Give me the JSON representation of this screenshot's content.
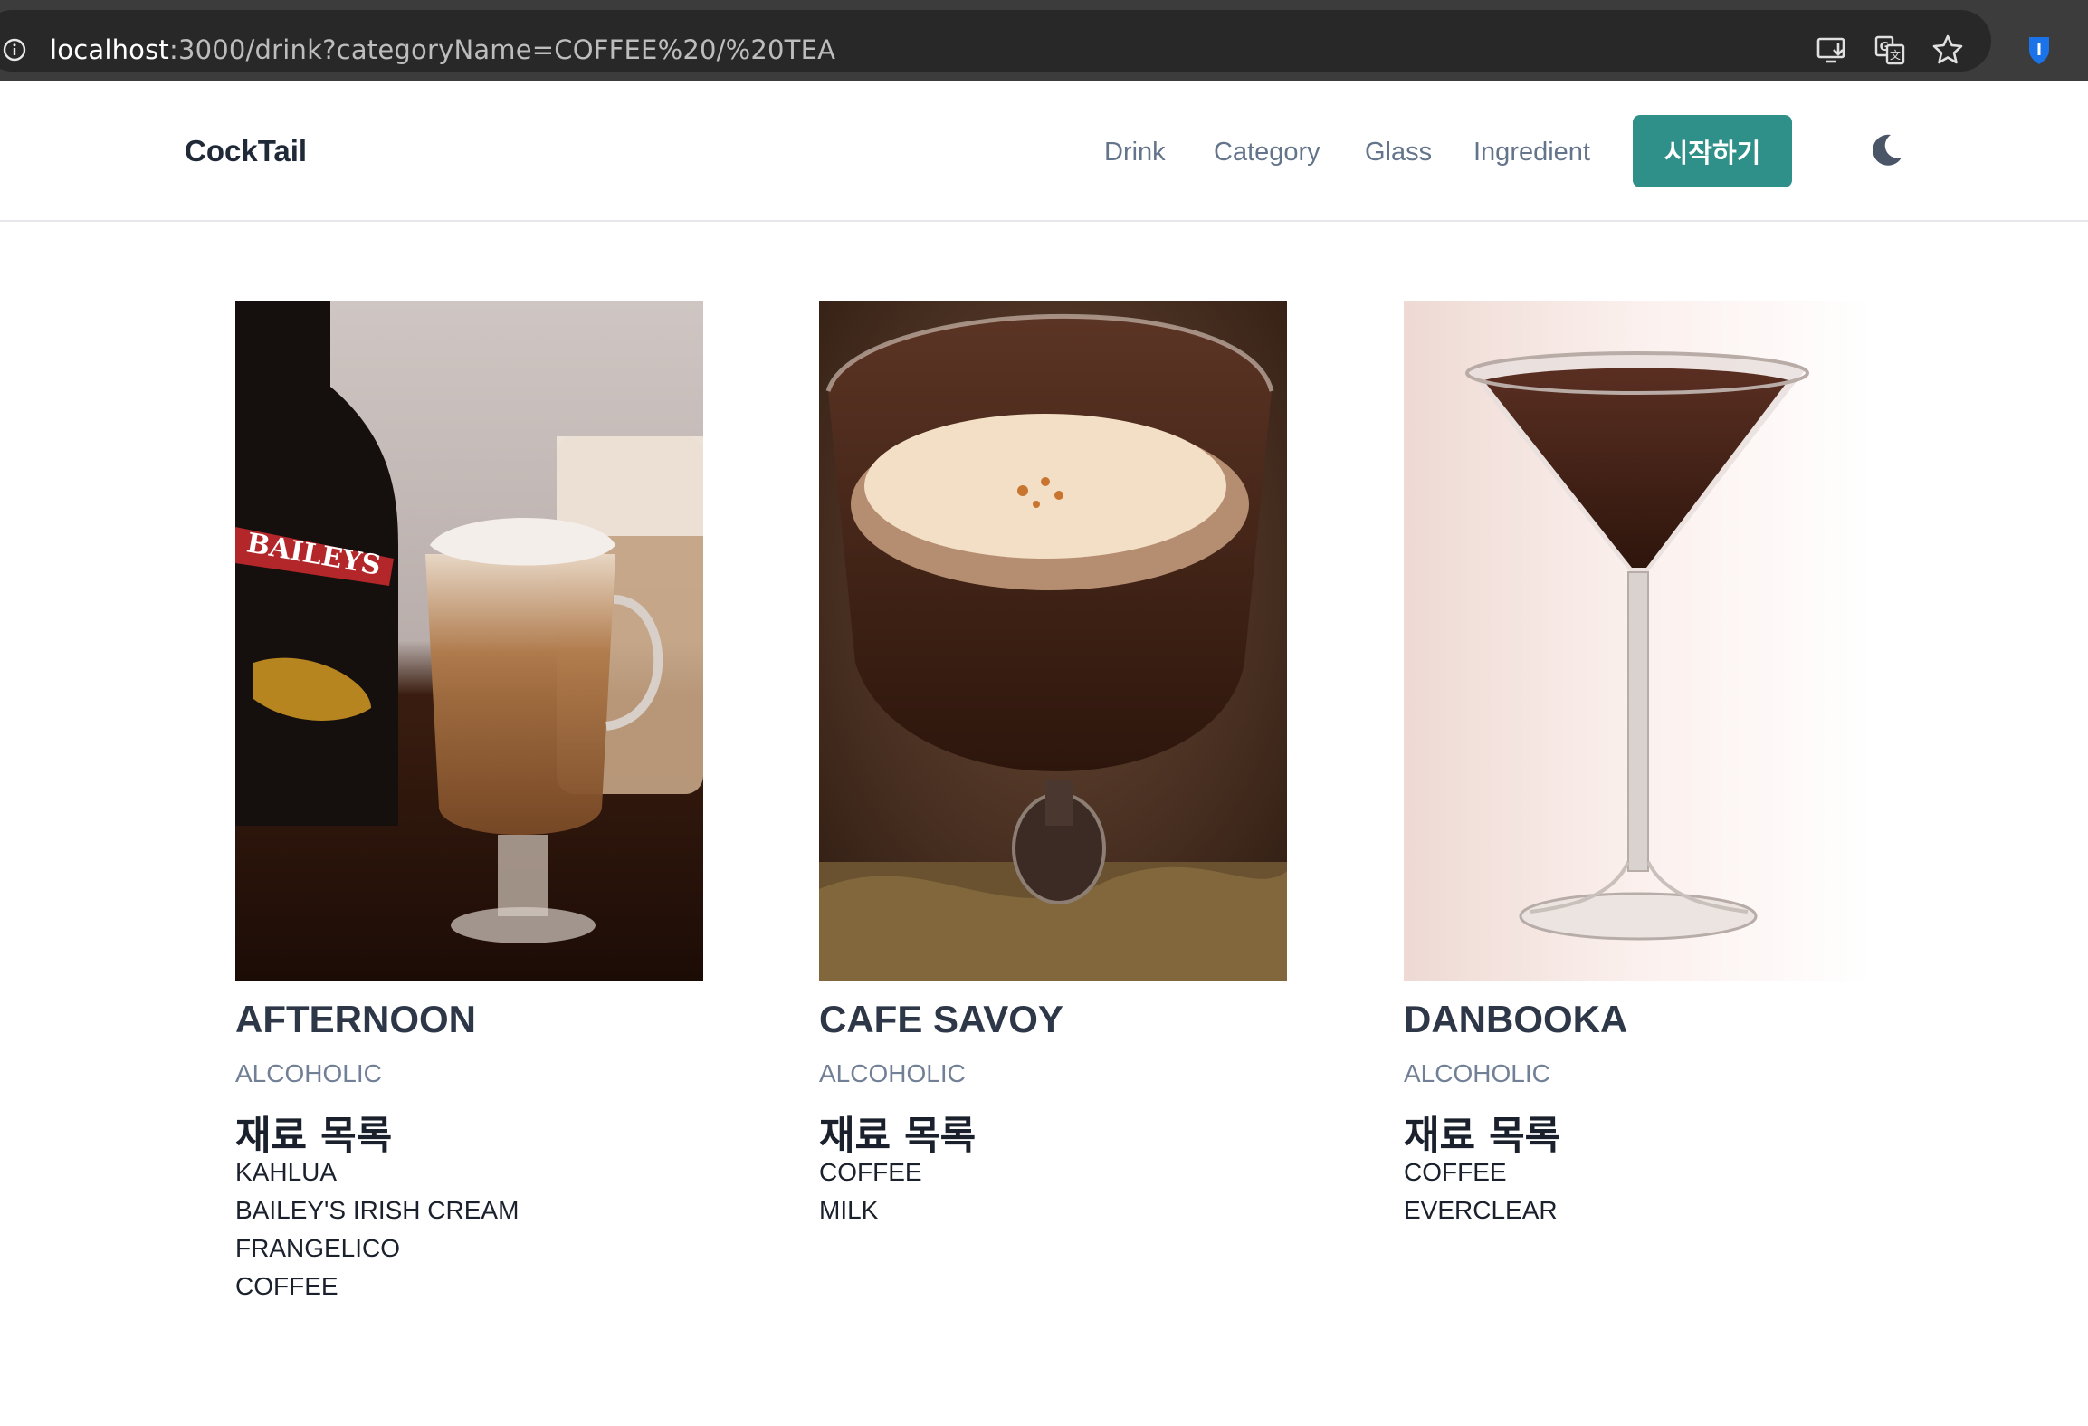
{
  "browser": {
    "url_host": "localhost",
    "url_rest": ":3000/drink?categoryName=COFFEE%20/%20TEA"
  },
  "nav": {
    "brand": "CockTail",
    "links": [
      "Drink",
      "Category",
      "Glass",
      "Ingredient"
    ],
    "start_button": "시작하기"
  },
  "cards": [
    {
      "title": "AFTERNOON",
      "type": "ALCOHOLIC",
      "heading": "재료 목록",
      "ingredients": [
        "KAHLUA",
        "BAILEY'S IRISH CREAM",
        "FRANGELICO",
        "COFFEE"
      ]
    },
    {
      "title": "CAFE SAVOY",
      "type": "ALCOHOLIC",
      "heading": "재료 목록",
      "ingredients": [
        "COFFEE",
        "MILK"
      ]
    },
    {
      "title": "DANBOOKA",
      "type": "ALCOHOLIC",
      "heading": "재료 목록",
      "ingredients": [
        "COFFEE",
        "EVERCLEAR"
      ]
    }
  ],
  "photo_logo_text": "BAILEYS",
  "colors": {
    "accent": "#2f8f89",
    "chrome_bg": "#3c3c3c",
    "omnibox_bg": "#282828",
    "title_text": "#2d3748",
    "muted_text": "#718096",
    "nav_text": "#64748b"
  },
  "icons": {
    "omnibox": "info-icon",
    "toolbar": [
      "install-app-icon",
      "translate-icon",
      "bookmark-star-icon",
      "bitwarden-shield-icon"
    ],
    "theme_toggle": "moon-icon"
  }
}
